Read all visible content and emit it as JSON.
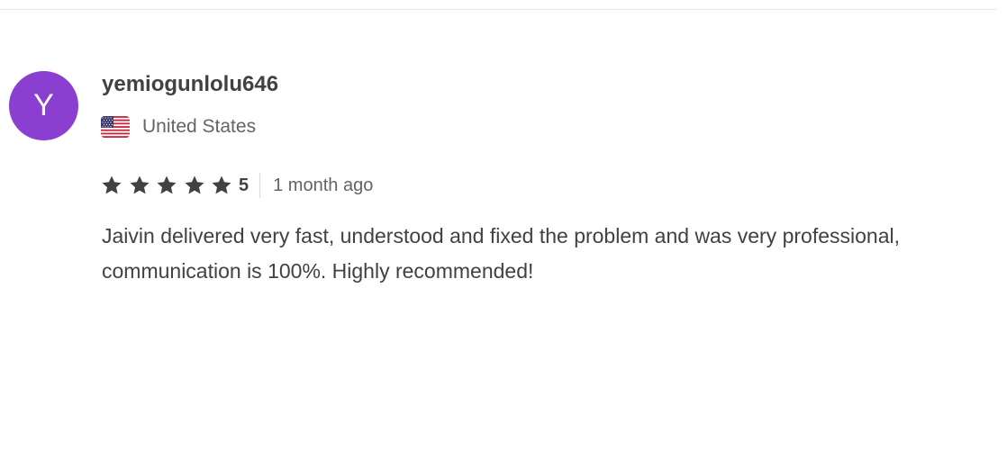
{
  "reviewer": {
    "avatar_letter": "Y",
    "avatar_color": "#8a3fd1",
    "username": "yemiogunlolu646",
    "country": "United States",
    "flag_icon": "us-flag-icon"
  },
  "rating": {
    "stars": 5,
    "max_stars": 5,
    "value_label": "5",
    "star_color": "#404145"
  },
  "time_ago": "1 month ago",
  "review_text": "Jaivin delivered very fast, understood and fixed the problem and was very professional, communication is 100%. Highly recommended!"
}
